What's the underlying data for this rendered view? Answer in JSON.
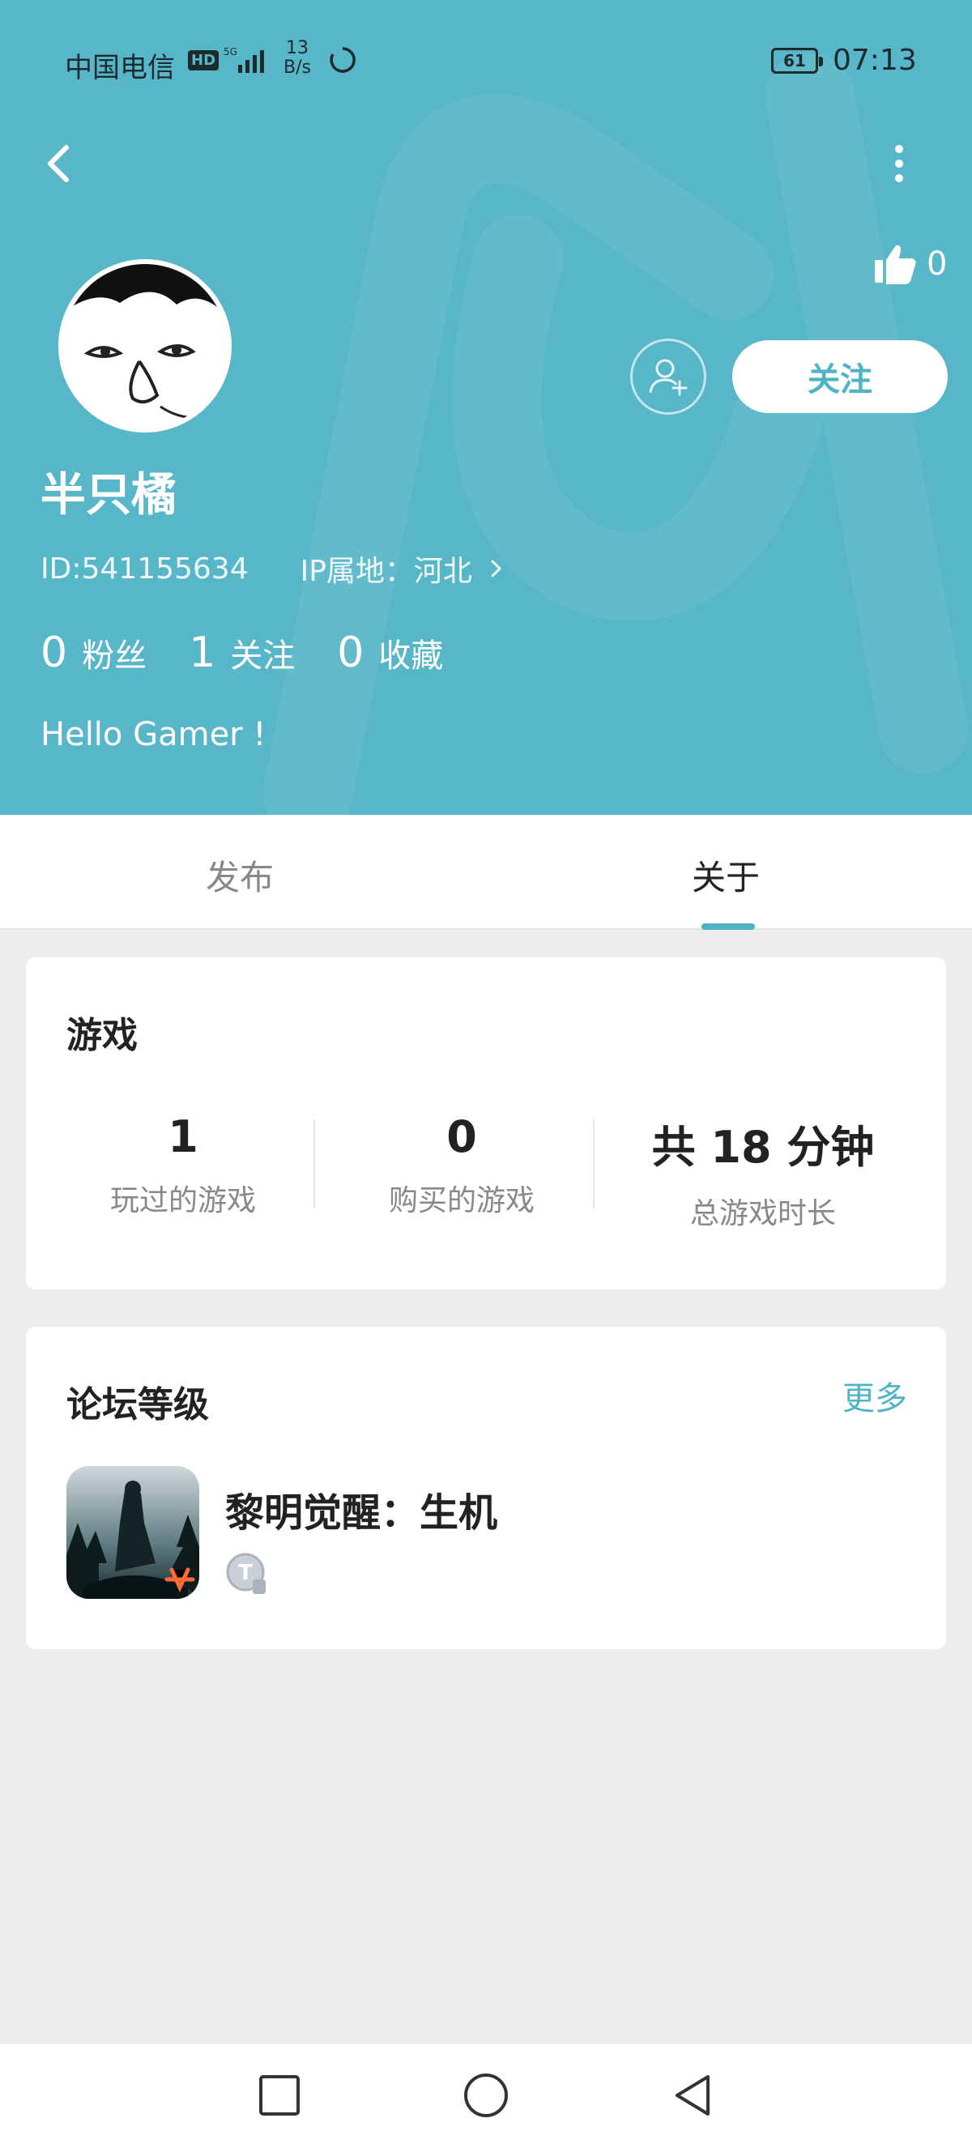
{
  "status_bar": {
    "carrier": "中国电信",
    "hd": "HD",
    "network_speed_value": "13",
    "network_speed_unit": "B/s",
    "battery": "61",
    "time": "07:13"
  },
  "profile": {
    "likes": "0",
    "username": "半只橘",
    "id_text": "ID:541155634",
    "ip_text": "IP属地：河北",
    "follow_label": "关注",
    "stats": [
      {
        "value": "0",
        "label": "粉丝"
      },
      {
        "value": "1",
        "label": "关注"
      },
      {
        "value": "0",
        "label": "收藏"
      }
    ],
    "bio": "Hello Gamer !"
  },
  "tabs": [
    {
      "label": "发布",
      "active": false
    },
    {
      "label": "关于",
      "active": true
    }
  ],
  "games_card": {
    "title": "游戏",
    "stats": [
      {
        "value": "1",
        "label": "玩过的游戏"
      },
      {
        "value": "0",
        "label": "购买的游戏"
      },
      {
        "value": "共 18 分钟",
        "label": "总游戏时长"
      }
    ]
  },
  "forum_card": {
    "title": "论坛等级",
    "more_label": "更多",
    "game_name": "黎明觉醒：生机",
    "level_badge": "T"
  },
  "colors": {
    "accent": "#4fb3c6",
    "header_bg": "#57b6c8"
  }
}
